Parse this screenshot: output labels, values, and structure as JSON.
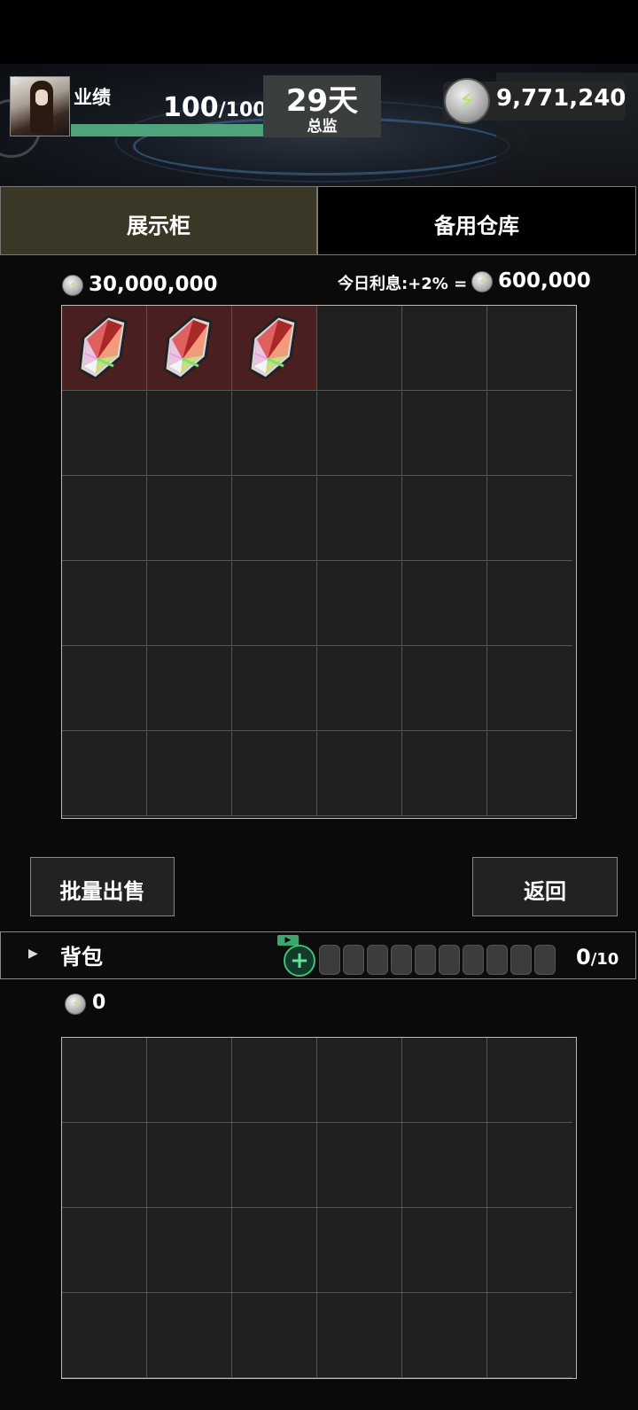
{
  "header": {
    "perf_label": "业绩",
    "perf_value": "100",
    "perf_max": "/100",
    "perf_progress": 1.0,
    "day": "29天",
    "role": "总监",
    "money": "9,771,240"
  },
  "tabs": [
    {
      "label": "展示柜",
      "active": true
    },
    {
      "label": "备用仓库",
      "active": false
    }
  ],
  "display": {
    "value": "30,000,000",
    "interest_label": "今日利息:+2% =",
    "interest_value": "600,000",
    "items": [
      "crystal-gem",
      "crystal-gem",
      "crystal-gem"
    ]
  },
  "buttons": {
    "batch_sell": "批量出售",
    "back": "返回"
  },
  "backpack": {
    "title": "背包",
    "ad_tag": "▶",
    "add_label": "+",
    "count": "0",
    "capacity": "/10",
    "value": "0",
    "slots": 10
  },
  "colors": {
    "accent_green": "#4fa37a",
    "active_tab": "#3a3726",
    "filled_cell": "#4a1f20"
  }
}
